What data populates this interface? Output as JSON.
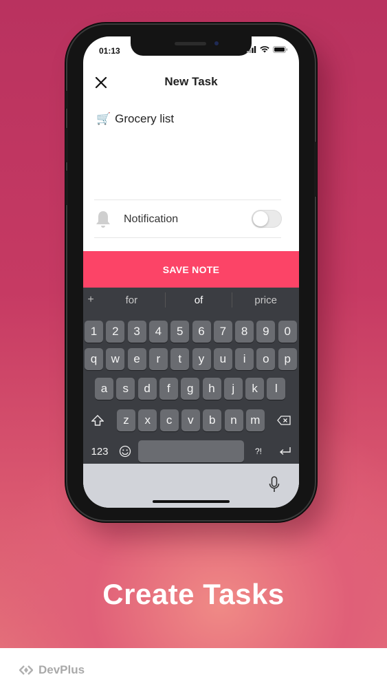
{
  "status_bar": {
    "time": "01:13"
  },
  "header": {
    "title": "New Task"
  },
  "task": {
    "emoji": "🛒",
    "text": "Grocery list"
  },
  "notification": {
    "label": "Notification",
    "enabled": false
  },
  "save_button": {
    "label": "SAVE NOTE",
    "color": "#fc4467"
  },
  "keyboard": {
    "suggestions": [
      "for",
      "of",
      "price"
    ],
    "number_row": [
      "1",
      "2",
      "3",
      "4",
      "5",
      "6",
      "7",
      "8",
      "9",
      "0"
    ],
    "row_q": [
      "q",
      "w",
      "e",
      "r",
      "t",
      "y",
      "u",
      "i",
      "o",
      "p"
    ],
    "row_a": [
      "a",
      "s",
      "d",
      "f",
      "g",
      "h",
      "j",
      "k",
      "l"
    ],
    "row_z": [
      "z",
      "x",
      "c",
      "v",
      "b",
      "n",
      "m"
    ],
    "mode_key": "123",
    "punct_key": "?!"
  },
  "caption": "Create Tasks",
  "footer": {
    "brand": "DevPlus"
  }
}
